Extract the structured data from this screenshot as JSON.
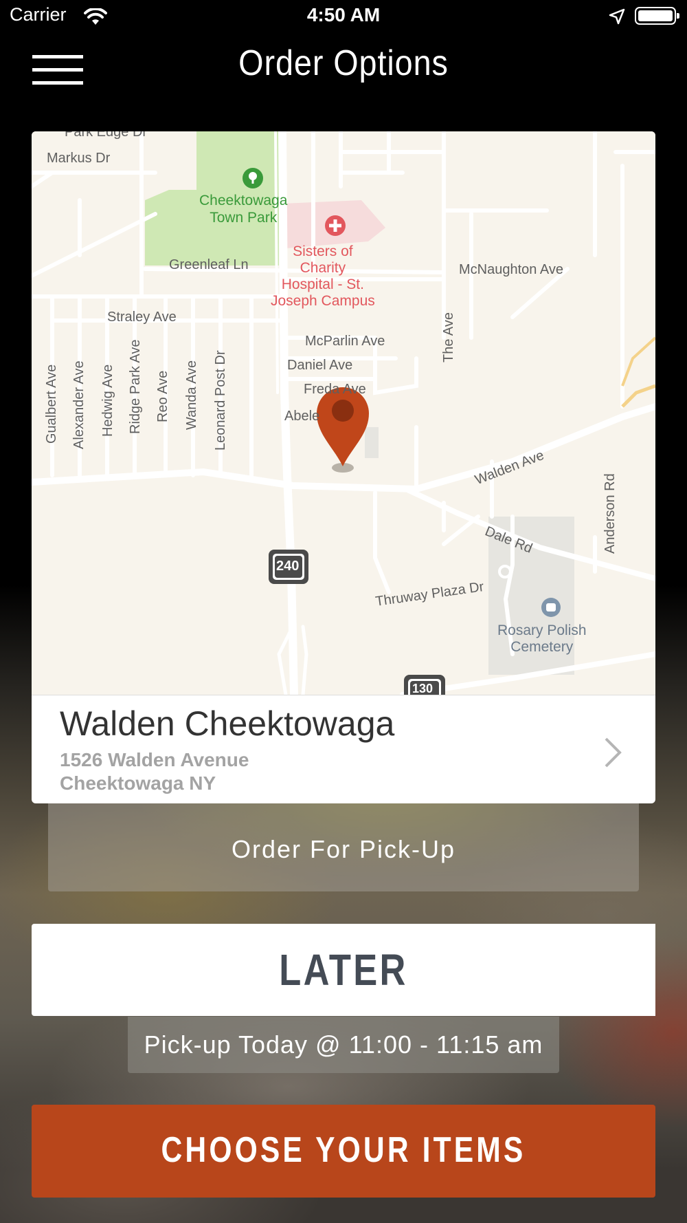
{
  "status_bar": {
    "carrier": "Carrier",
    "time": "4:50 AM"
  },
  "header": {
    "title": "Order Options",
    "menu_icon": "hamburger-menu-icon"
  },
  "map": {
    "labels": {
      "park_edge": "Park Edge Dr",
      "markus": "Markus Dr",
      "park_name": "Cheektowaga\nTown Park",
      "hospital": "Sisters of\nCharity\nHospital - St.\nJoseph Campus",
      "greenleaf": "Greenleaf Ln",
      "mcnaughton": "McNaughton Ave",
      "straley": "Straley Ave",
      "mcparlin": "McParlin Ave",
      "daniel": "Daniel Ave",
      "freda": "Freda Ave",
      "abele": "Abele",
      "walden": "Walden Ave",
      "dale": "Dale Rd",
      "thruway": "Thruway Plaza Dr",
      "cemetery": "Rosary Polish\nCemetery",
      "the_ave": "The Ave",
      "anderson": "Anderson Rd",
      "gualbert": "Gualbert Ave",
      "alexander": "Alexander Ave",
      "hedwig": "Hedwig Ave",
      "ridge_park": "Ridge Park Ave",
      "reo": "Reo Ave",
      "wanda": "Wanda Ave",
      "leonard_post": "Leonard Post Dr",
      "route_240": "240",
      "route_130": "130"
    },
    "pin_color": "#c0461a"
  },
  "store": {
    "name": "Walden Cheektowaga",
    "address_line1": "1526 Walden Avenue",
    "address_line2": "Cheektowaga NY"
  },
  "order_type": {
    "label": "Order For Pick-Up"
  },
  "timing": {
    "label": "LATER",
    "pickup_text": "Pick-up Today @ 11:00 - 11:15 am"
  },
  "cta": {
    "label": "CHOOSE YOUR ITEMS",
    "color": "#b8461b"
  }
}
